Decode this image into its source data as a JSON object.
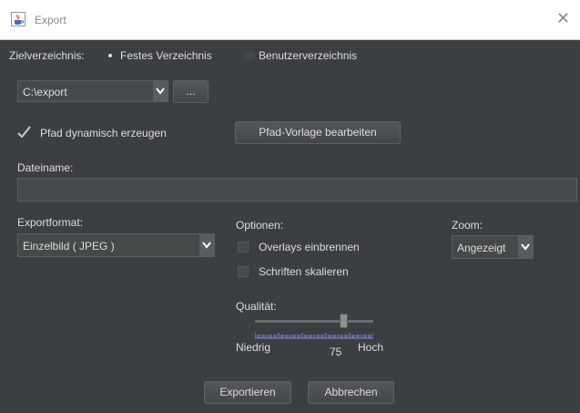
{
  "window": {
    "title": "Export",
    "close_glyph": "✕"
  },
  "target": {
    "label": "Zielverzeichnis:",
    "options": [
      "Festes Verzeichnis",
      "Benutzerverzeichnis"
    ],
    "selected": "Festes Verzeichnis"
  },
  "path": {
    "value": "C:\\export",
    "browse_label": "..."
  },
  "dynamic_path": {
    "label": "Pfad dynamisch erzeugen",
    "checked": true,
    "template_button": "Pfad-Vorlage bearbeiten"
  },
  "filename": {
    "label": "Dateiname:",
    "value": ""
  },
  "format": {
    "label": "Exportformat:",
    "value": "Einzelbild ( JPEG )"
  },
  "options": {
    "label": "Optionen:",
    "items": [
      {
        "label": "Overlays einbrennen",
        "checked": false
      },
      {
        "label": "Schriften skalieren",
        "checked": false
      }
    ]
  },
  "zoom": {
    "label": "Zoom:",
    "value": "Angezeigt"
  },
  "quality": {
    "label": "Qualität:",
    "value": "75",
    "min_label": "Niedrig",
    "max_label": "Hoch",
    "level": 0.75
  },
  "actions": {
    "export": "Exportieren",
    "cancel": "Abbrechen"
  },
  "icons": {
    "app": "java-cup-icon",
    "close": "close-icon",
    "dropdown": "chevron-down-icon",
    "check": "checkmark-icon"
  },
  "colors": {
    "background": "#3c3f41",
    "text": "#dcdcdc",
    "field": "#45494a"
  }
}
